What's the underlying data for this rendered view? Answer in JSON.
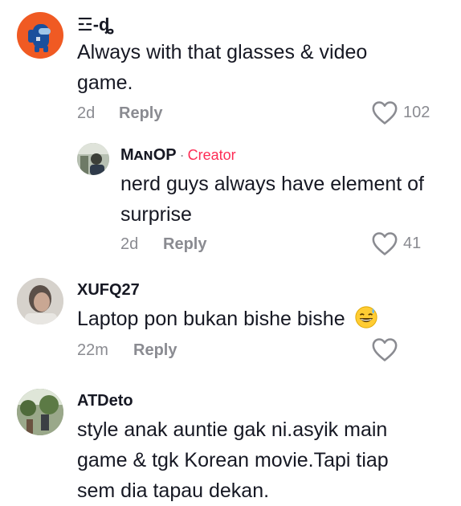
{
  "comments": [
    {
      "username": "☲-ȡ",
      "text": "Always with that glasses & video game.",
      "time": "2d",
      "reply": "Reply",
      "likes": "102",
      "avatar_icon": "among-us-crewmate-icon"
    },
    {
      "username": "MᴀɴOP",
      "badge": "Creator",
      "text": "nerd guys always have element of surprise",
      "time": "2d",
      "reply": "Reply",
      "likes": "41"
    },
    {
      "username": "XUFQ27",
      "text": "Laptop pon bukan bishe bishe",
      "emoji": "grinning-sweat-emoji",
      "time": "22m",
      "reply": "Reply",
      "likes": ""
    },
    {
      "username": "ATDeto",
      "text": "style anak auntie gak ni.asyik main game & tgk Korean movie.Tapi tiap sem dia tapau dekan."
    }
  ],
  "colors": {
    "text": "#161823",
    "muted": "#8a8b91",
    "creator": "#fe2c55",
    "avatar1_bg": "#f05a23",
    "avatar1_fg": "#1a4f9c"
  }
}
